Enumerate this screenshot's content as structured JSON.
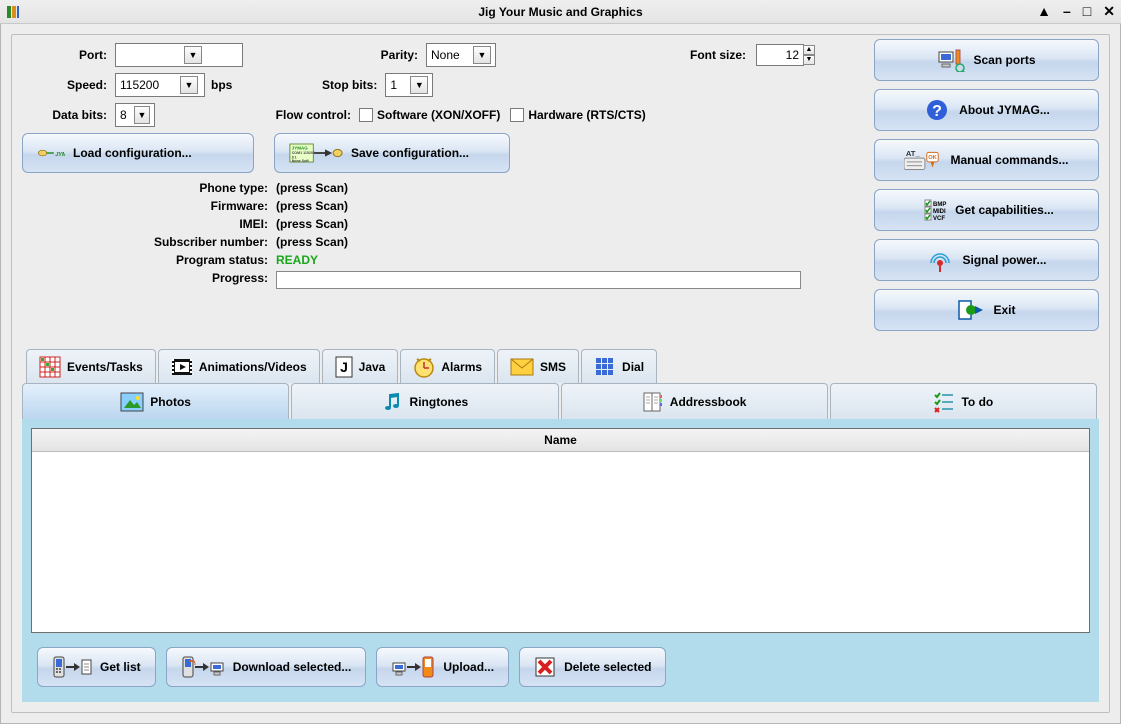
{
  "window": {
    "title": "Jig Your Music and Graphics"
  },
  "settings": {
    "port_label": "Port:",
    "port_value": "",
    "speed_label": "Speed:",
    "speed_value": "115200",
    "speed_unit": "bps",
    "databits_label": "Data bits:",
    "databits_value": "8",
    "parity_label": "Parity:",
    "parity_value": "None",
    "stopbits_label": "Stop bits:",
    "stopbits_value": "1",
    "flow_label": "Flow control:",
    "flow_soft_label": "Software (XON/XOFF)",
    "flow_hard_label": "Hardware (RTS/CTS)",
    "fontsize_label": "Font size:",
    "fontsize_value": "12"
  },
  "config_buttons": {
    "load": "Load configuration...",
    "save": "Save configuration..."
  },
  "info": {
    "phone_type_label": "Phone type:",
    "phone_type_value": "(press Scan)",
    "firmware_label": "Firmware:",
    "firmware_value": "(press Scan)",
    "imei_label": "IMEI:",
    "imei_value": "(press Scan)",
    "subscriber_label": "Subscriber number:",
    "subscriber_value": "(press Scan)",
    "status_label": "Program status:",
    "status_value": "READY",
    "progress_label": "Progress:"
  },
  "sidebar_buttons": {
    "scan": "Scan ports",
    "about": "About JYMAG...",
    "manual": "Manual commands...",
    "capab": "Get capabilities...",
    "signal": "Signal power...",
    "exit": "Exit"
  },
  "tabs_top": {
    "events": "Events/Tasks",
    "anim": "Animations/Videos",
    "java": "Java",
    "alarms": "Alarms",
    "sms": "SMS",
    "dial": "Dial"
  },
  "tabs_bottom": {
    "photos": "Photos",
    "ringtones": "Ringtones",
    "addressbook": "Addressbook",
    "todo": "To do"
  },
  "table": {
    "col_name": "Name"
  },
  "actions": {
    "getlist": "Get list",
    "download": "Download selected...",
    "upload": "Upload...",
    "delete": "Delete selected"
  }
}
